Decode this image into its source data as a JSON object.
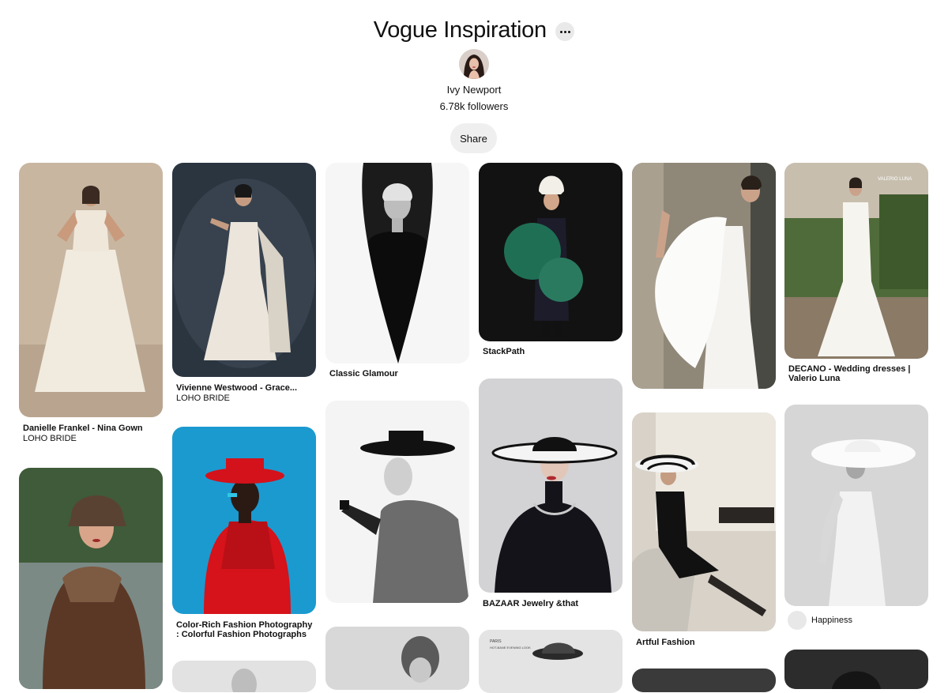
{
  "board": {
    "title": "Vogue Inspiration",
    "owner": "Ivy Newport",
    "followers": "6.78k followers",
    "share_label": "Share",
    "more_icon": "more-dots-icon"
  },
  "pins": [
    {
      "title": "Danielle Frankel - Nina Gown",
      "source": "LOHO BRIDE"
    },
    {
      "title": "",
      "source": ""
    },
    {
      "title": "Vivienne Westwood - Grace...",
      "source": "LOHO BRIDE"
    },
    {
      "title": "Color-Rich Fashion Photography",
      "title2": ": Colorful Fashion Photographs",
      "source": ""
    },
    {
      "title": "",
      "source": ""
    },
    {
      "title": "Classic Glamour",
      "source": ""
    },
    {
      "title": "",
      "source": ""
    },
    {
      "title": "",
      "source": ""
    },
    {
      "title": "StackPath",
      "source": ""
    },
    {
      "title": "BAZAAR Jewelry &that",
      "source": ""
    },
    {
      "title": "",
      "source": ""
    },
    {
      "title": "",
      "source": ""
    },
    {
      "title": "Artful Fashion",
      "source": ""
    },
    {
      "title": "",
      "source": ""
    },
    {
      "title": "DECANO - Wedding dresses |",
      "title2": "Valerio Luna",
      "source": ""
    },
    {
      "title": "",
      "credit": "Happiness"
    },
    {
      "title": "",
      "source": ""
    }
  ],
  "image_text": {
    "watermark": "VALERIO LUNA",
    "magazine_line1": "PARIS",
    "magazine_line2": "HOT-BANE EVENING LOOK"
  },
  "colors": {
    "share_bg": "#efefef",
    "more_bg": "#e9e9e9",
    "card_radius_note": "rounded"
  }
}
